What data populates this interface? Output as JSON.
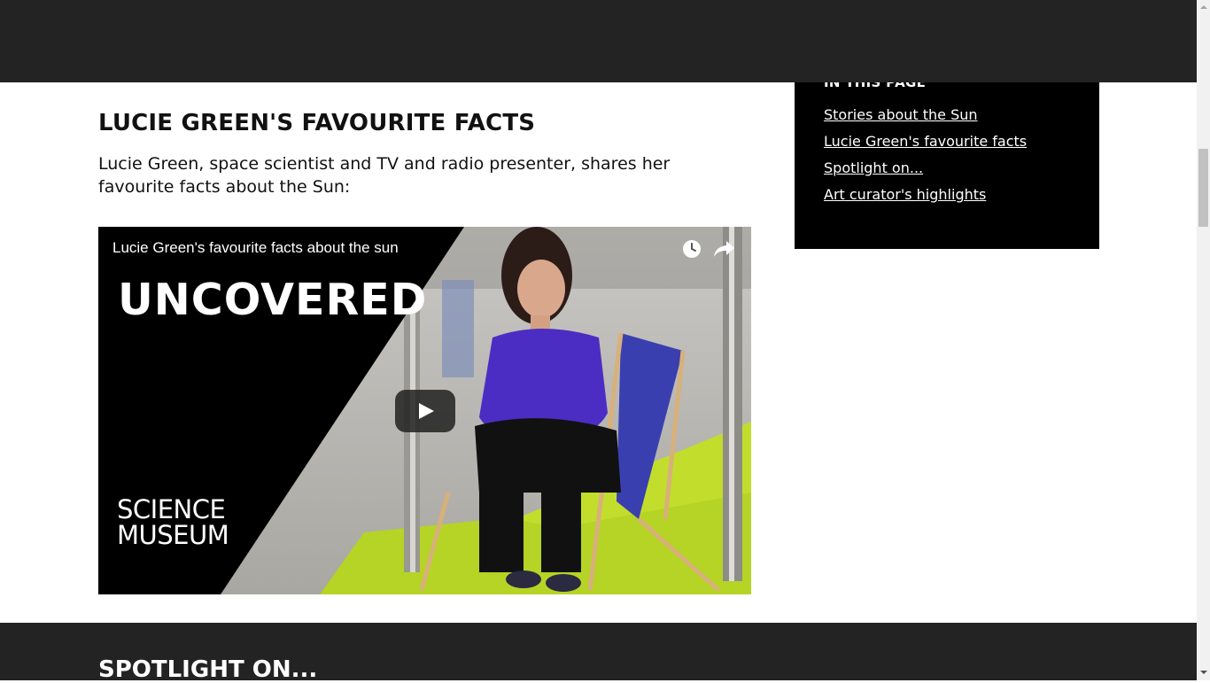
{
  "toc": {
    "title": "IN THIS PAGE",
    "items": [
      {
        "label": "Stories about the Sun"
      },
      {
        "label": "Lucie Green's favourite facts"
      },
      {
        "label": "Spotlight on..."
      },
      {
        "label": "Art curator's highlights"
      }
    ]
  },
  "section": {
    "heading": "LUCIE GREEN'S FAVOURITE FACTS",
    "intro": "Lucie Green, space scientist and TV and radio presenter, shares her favourite facts about the Sun:"
  },
  "video": {
    "title": "Lucie Green's favourite facts about the sun",
    "thumbnail_text": "UNCOVERED",
    "logo_line1": "SCIENCE",
    "logo_line2": "MUSEUM",
    "icons": {
      "watch_later": "clock-icon",
      "share": "share-arrow-icon",
      "play": "play-icon"
    }
  },
  "next_section": {
    "heading": "SPOTLIGHT ON..."
  },
  "colors": {
    "dark_band": "#232323",
    "toc_bg": "#000000",
    "thumbnail_green": "#b5d425"
  }
}
